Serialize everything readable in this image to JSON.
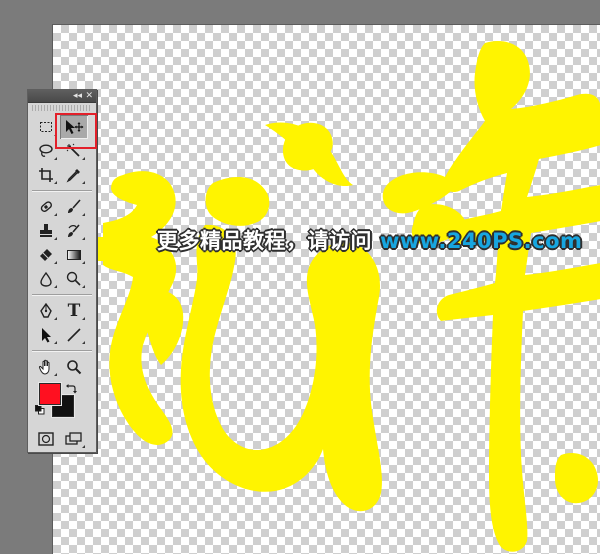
{
  "watermark": {
    "text_cn": "更多精品教程，请访问",
    "url": "www.240PS.com"
  },
  "colors": {
    "foreground": "#ff1020",
    "background": "#111111",
    "artwork_fill": "#fff400",
    "highlight": "#e3202a"
  },
  "toolbox": {
    "collapse_glyph": "◂◂",
    "close_glyph": "✕",
    "tools": [
      [
        "rectangular-marquee-icon",
        "move-icon"
      ],
      [
        "lasso-icon",
        "magic-wand-icon"
      ],
      [
        "crop-icon",
        "eyedropper-icon"
      ],
      [
        "spot-healing-brush-icon",
        "brush-icon"
      ],
      [
        "clone-stamp-icon",
        "history-brush-icon"
      ],
      [
        "eraser-icon",
        "gradient-icon"
      ],
      [
        "blur-icon",
        "dodge-icon"
      ],
      [
        "pen-icon",
        "type-icon"
      ],
      [
        "path-selection-icon",
        "line-icon"
      ],
      [
        "hand-icon",
        "zoom-icon"
      ]
    ],
    "type_tool_glyph": "T",
    "selected_tool": "move-icon"
  }
}
